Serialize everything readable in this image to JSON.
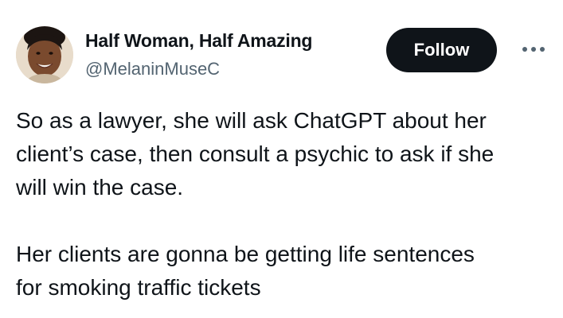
{
  "author": {
    "display_name": "Half Woman, Half Amazing",
    "handle": "@MelaninMuseC",
    "avatar_icon": "profile-photo"
  },
  "actions": {
    "follow_label": "Follow",
    "more_icon": "more-options-icon"
  },
  "tweet": {
    "paragraph_1": "So as a lawyer, she will ask ChatGPT about her\nclient’s case, then consult a psychic to ask if she\nwill win the case.",
    "paragraph_2": "Her clients are gonna be getting life sentences\nfor smoking traffic tickets"
  },
  "colors": {
    "text": "#0f1419",
    "secondary_text": "#536471",
    "follow_bg": "#0f1419",
    "follow_text": "#ffffff"
  }
}
